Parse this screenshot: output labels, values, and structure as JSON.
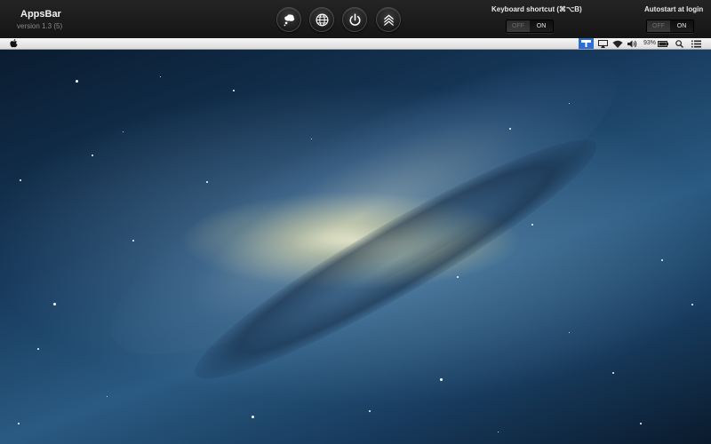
{
  "panel": {
    "app_name": "AppsBar",
    "version": "version 1.3 (5)",
    "buttons": [
      {
        "name": "thought-bubble-button",
        "icon": "thought-bubble-icon"
      },
      {
        "name": "globe-button",
        "icon": "globe-icon"
      },
      {
        "name": "power-button",
        "icon": "power-icon"
      },
      {
        "name": "chevrons-up-button",
        "icon": "chevrons-up-icon"
      }
    ],
    "keyboard_shortcut": {
      "label": "Keyboard shortcut (⌘⌥B)",
      "off_label": "OFF",
      "on_label": "ON",
      "value": "ON"
    },
    "autostart": {
      "label": "Autostart at login",
      "off_label": "OFF",
      "on_label": "ON",
      "value": "ON"
    }
  },
  "menubar": {
    "apple_icon": "apple-icon",
    "status_items": [
      "appsbar-icon",
      "airplay-icon",
      "wifi-icon",
      "volume-icon",
      "battery-icon",
      "spotlight-icon",
      "notification-center-icon"
    ],
    "battery_percent": "93%"
  },
  "desktop": {
    "wallpaper": "galaxy"
  },
  "colors": {
    "panel_bg": "#1c1c1c",
    "menubar_bg": "#ececec",
    "highlight": "#2b6fd6"
  }
}
